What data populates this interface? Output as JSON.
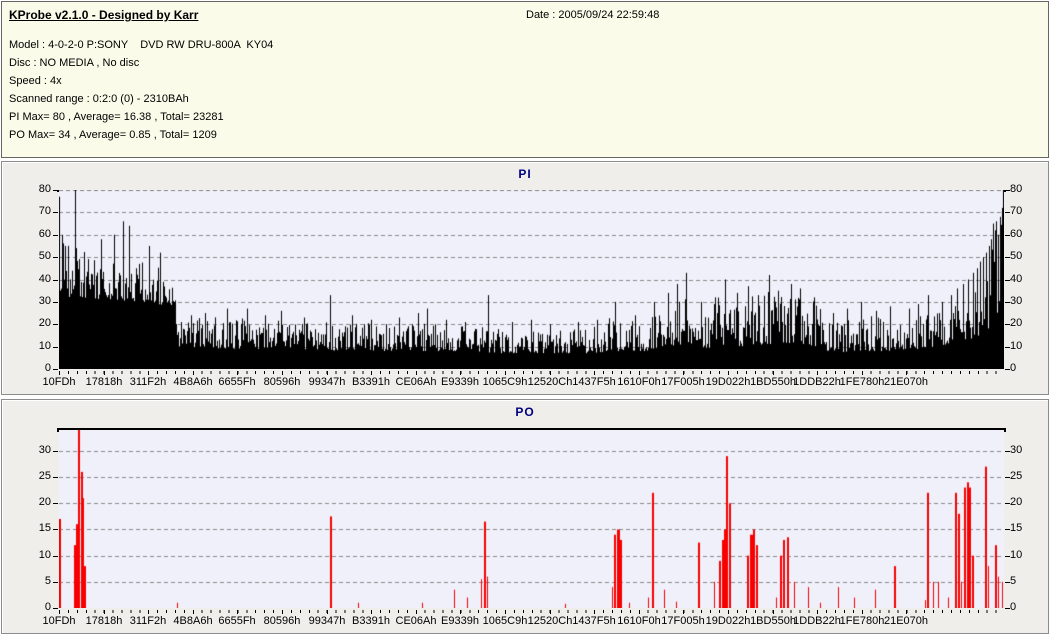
{
  "window": {
    "title": "KProbe v2.1.0 - Designed by Karr",
    "date_label": "Date : 2005/09/24 22:59:48"
  },
  "info": {
    "model": "Model : 4-0-2-0 P:SONY    DVD RW DRU-800A  KY04",
    "disc": "Disc : NO MEDIA , No disc",
    "speed": "Speed : 4x",
    "scanned_range": "Scanned range : 0:2:0 (0) - 2310BAh",
    "pi_summary": "PI Max= 80 , Average= 16.38 , Total= 23281",
    "po_summary": "PO Max= 34 , Average= 0.85 , Total= 1209"
  },
  "colors": {
    "header_bg": "#FBFBEA",
    "panel_bg": "#EFEEEA",
    "plot_bg": "#F0F0FA",
    "grid": "#8A8A8A",
    "title_text": "#000080",
    "pi_bar": "#000000",
    "po_bar": "#F70000"
  },
  "chart_data": [
    {
      "type": "bar",
      "title": "PI",
      "ylabel": "",
      "xlabel": "",
      "ylim": [
        0,
        80
      ],
      "yticks": [
        0,
        10,
        20,
        30,
        40,
        50,
        60,
        70,
        80
      ],
      "grid": "dashed",
      "legend": "none",
      "categories": [
        "10FDh",
        "17818h",
        "311F2h",
        "4B8A6h",
        "6655Fh",
        "80596h",
        "99347h",
        "B3391h",
        "CE06Ah",
        "E9339h",
        "1065C9h",
        "12520Ch",
        "1437F5h",
        "1610F0h",
        "17F005h",
        "19D022h",
        "1BD550h",
        "1DDB22h",
        "1FE780h",
        "21E070h"
      ],
      "stats": {
        "max": 80,
        "average": 16.38,
        "total": 23281
      },
      "bar_color": "#000000",
      "top_border": false,
      "noise_seed": 987654321,
      "profile": [
        [
          0,
          34,
          60
        ],
        [
          0.01,
          32,
          55
        ],
        [
          0.05,
          31,
          54
        ],
        [
          0.09,
          30,
          50
        ],
        [
          0.12,
          28,
          47
        ],
        [
          0.127,
          10,
          24
        ],
        [
          0.18,
          9,
          23
        ],
        [
          0.25,
          9,
          22
        ],
        [
          0.3,
          8,
          21
        ],
        [
          0.36,
          8,
          20
        ],
        [
          0.42,
          8,
          22
        ],
        [
          0.47,
          7,
          18
        ],
        [
          0.52,
          7,
          17
        ],
        [
          0.56,
          7,
          19
        ],
        [
          0.59,
          8,
          24
        ],
        [
          0.62,
          8,
          22
        ],
        [
          0.645,
          10,
          32
        ],
        [
          0.668,
          11,
          36
        ],
        [
          0.685,
          9,
          26
        ],
        [
          0.7,
          11,
          34
        ],
        [
          0.72,
          10,
          28
        ],
        [
          0.745,
          11,
          36
        ],
        [
          0.78,
          11,
          33
        ],
        [
          0.8,
          10,
          30
        ],
        [
          0.82,
          7,
          21
        ],
        [
          0.85,
          8,
          24
        ],
        [
          0.88,
          8,
          23
        ],
        [
          0.91,
          9,
          26
        ],
        [
          0.93,
          10,
          28
        ],
        [
          0.95,
          12,
          33
        ],
        [
          0.97,
          14,
          40
        ],
        [
          0.985,
          18,
          52
        ],
        [
          0.995,
          26,
          62
        ],
        [
          1,
          36,
          72
        ]
      ],
      "spikes": [
        [
          0.0005,
          77
        ],
        [
          0.003,
          60
        ],
        [
          0.006,
          55
        ],
        [
          0.017,
          80
        ],
        [
          0.045,
          58
        ],
        [
          0.058,
          60
        ],
        [
          0.068,
          66
        ],
        [
          0.074,
          64
        ],
        [
          0.095,
          55
        ],
        [
          0.107,
          52
        ],
        [
          0.14,
          24
        ],
        [
          0.155,
          25
        ],
        [
          0.178,
          27
        ],
        [
          0.199,
          27
        ],
        [
          0.218,
          24
        ],
        [
          0.235,
          26
        ],
        [
          0.26,
          23
        ],
        [
          0.287,
          33
        ],
        [
          0.31,
          24
        ],
        [
          0.33,
          22
        ],
        [
          0.36,
          23
        ],
        [
          0.38,
          25
        ],
        [
          0.39,
          27
        ],
        [
          0.41,
          22
        ],
        [
          0.43,
          21
        ],
        [
          0.454,
          33
        ],
        [
          0.48,
          21
        ],
        [
          0.5,
          22
        ],
        [
          0.52,
          20
        ],
        [
          0.55,
          21
        ],
        [
          0.57,
          22
        ],
        [
          0.589,
          30
        ],
        [
          0.61,
          24
        ],
        [
          0.63,
          30
        ],
        [
          0.645,
          34
        ],
        [
          0.655,
          38
        ],
        [
          0.664,
          43
        ],
        [
          0.68,
          30
        ],
        [
          0.695,
          32
        ],
        [
          0.706,
          40
        ],
        [
          0.718,
          34
        ],
        [
          0.73,
          37
        ],
        [
          0.74,
          33
        ],
        [
          0.752,
          42
        ],
        [
          0.762,
          35
        ],
        [
          0.775,
          38
        ],
        [
          0.785,
          36
        ],
        [
          0.8,
          32
        ],
        [
          0.82,
          25
        ],
        [
          0.835,
          27
        ],
        [
          0.85,
          30
        ],
        [
          0.865,
          26
        ],
        [
          0.88,
          28
        ],
        [
          0.9,
          27
        ],
        [
          0.91,
          29
        ],
        [
          0.921,
          33
        ],
        [
          0.935,
          30
        ],
        [
          0.945,
          33
        ],
        [
          0.951,
          36
        ],
        [
          0.958,
          38
        ],
        [
          0.963,
          40
        ],
        [
          0.968,
          43
        ],
        [
          0.972,
          45
        ],
        [
          0.976,
          48
        ],
        [
          0.979,
          50
        ],
        [
          0.982,
          52
        ],
        [
          0.985,
          55
        ],
        [
          0.987,
          58
        ],
        [
          0.989,
          65
        ],
        [
          0.991,
          62
        ],
        [
          0.993,
          66
        ],
        [
          0.995,
          60
        ],
        [
          0.997,
          68
        ],
        [
          0.9985,
          72
        ],
        [
          0.9995,
          80
        ]
      ]
    },
    {
      "type": "bar",
      "title": "PO",
      "ylabel": "",
      "xlabel": "",
      "ylim": [
        0,
        34
      ],
      "yticks": [
        0,
        5,
        10,
        15,
        20,
        25,
        30
      ],
      "grid": "dashed",
      "legend": "none",
      "categories": [
        "10FDh",
        "17818h",
        "311F2h",
        "4B8A6h",
        "6655Fh",
        "80596h",
        "99347h",
        "B3391h",
        "CE06Ah",
        "E9339h",
        "1065C9h",
        "12520Ch",
        "1437F5h",
        "1610F0h",
        "17F005h",
        "19D022h",
        "1BD550h",
        "1DDB22h",
        "1FE780h",
        "21E070h"
      ],
      "stats": {
        "max": 34,
        "average": 0.85,
        "total": 1209
      },
      "bar_color": "#F70000",
      "top_border": true,
      "spikes": [
        [
          0.0005,
          17,
          2
        ],
        [
          0.016,
          12,
          2
        ],
        [
          0.018,
          16,
          2
        ],
        [
          0.0205,
          34,
          2
        ],
        [
          0.023,
          26,
          2
        ],
        [
          0.0248,
          21,
          2
        ],
        [
          0.0265,
          8,
          2
        ],
        [
          0.125,
          1,
          1
        ],
        [
          0.287,
          17.5,
          2
        ],
        [
          0.317,
          1,
          1
        ],
        [
          0.385,
          1,
          1
        ],
        [
          0.418,
          3.5,
          1
        ],
        [
          0.432,
          2,
          1
        ],
        [
          0.447,
          5.5,
          1
        ],
        [
          0.45,
          16.5,
          2
        ],
        [
          0.453,
          6,
          1
        ],
        [
          0.536,
          0.8,
          1
        ],
        [
          0.586,
          4,
          1
        ],
        [
          0.588,
          14,
          2
        ],
        [
          0.591,
          15,
          3
        ],
        [
          0.594,
          13,
          2
        ],
        [
          0.604,
          1,
          1
        ],
        [
          0.624,
          2,
          1
        ],
        [
          0.628,
          22,
          2
        ],
        [
          0.641,
          3.5,
          1
        ],
        [
          0.654,
          1.2,
          1
        ],
        [
          0.677,
          12.5,
          2
        ],
        [
          0.694,
          5,
          1
        ],
        [
          0.699,
          9,
          2
        ],
        [
          0.702,
          13,
          2
        ],
        [
          0.7045,
          15,
          3
        ],
        [
          0.707,
          29,
          2
        ],
        [
          0.7095,
          20,
          2
        ],
        [
          0.729,
          10,
          2
        ],
        [
          0.732,
          14,
          3
        ],
        [
          0.735,
          15,
          2
        ],
        [
          0.738,
          12,
          2
        ],
        [
          0.76,
          2,
          1
        ],
        [
          0.764,
          10,
          2
        ],
        [
          0.767,
          13,
          2
        ],
        [
          0.771,
          13.5,
          2
        ],
        [
          0.779,
          5,
          1
        ],
        [
          0.793,
          4,
          1
        ],
        [
          0.806,
          1,
          1
        ],
        [
          0.825,
          4,
          1
        ],
        [
          0.842,
          2,
          1
        ],
        [
          0.864,
          3.5,
          1
        ],
        [
          0.885,
          8,
          2
        ],
        [
          0.917,
          1.5,
          1
        ],
        [
          0.92,
          22,
          2
        ],
        [
          0.926,
          5,
          1
        ],
        [
          0.931,
          5,
          1
        ],
        [
          0.942,
          2,
          1
        ],
        [
          0.949,
          22,
          2
        ],
        [
          0.9525,
          18,
          2
        ],
        [
          0.956,
          5,
          1
        ],
        [
          0.959,
          23,
          2
        ],
        [
          0.962,
          24,
          2
        ],
        [
          0.9645,
          23,
          2
        ],
        [
          0.967,
          10,
          2
        ],
        [
          0.981,
          27,
          2
        ],
        [
          0.984,
          8,
          1
        ],
        [
          0.991,
          12,
          2
        ],
        [
          0.995,
          6,
          1
        ],
        [
          0.999,
          5,
          1
        ]
      ]
    }
  ]
}
